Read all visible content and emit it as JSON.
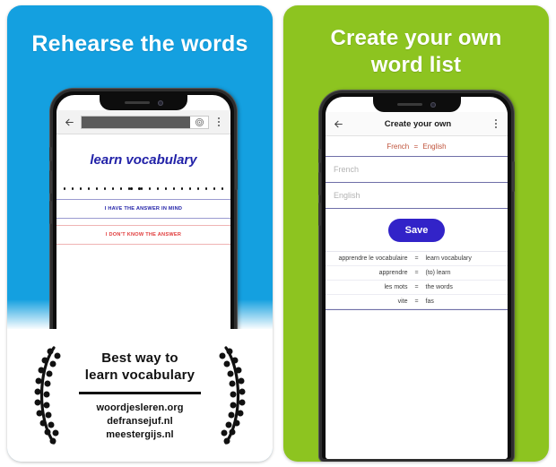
{
  "theme": {
    "blue": "#14a0e0",
    "green": "#8dc420",
    "navy": "#2222a8",
    "red": "#e03a3a",
    "save_button": "#3223c8",
    "lang_header": "#c0543c"
  },
  "left_card": {
    "headline": "Rehearse the words",
    "browser": {
      "back_icon": "back-arrow-icon",
      "url_value": "",
      "url_icon": "page-info-icon",
      "menu_icon": "kebab-menu-icon"
    },
    "page": {
      "title": "learn vocabulary",
      "blanks_pattern": [
        9,
        2,
        11
      ],
      "answer_known": "I HAVE THE ANSWER IN MIND",
      "answer_unknown": "I DON'T KNOW THE ANSWER"
    },
    "promo": {
      "title_line1": "Best way to",
      "title_line2": "learn vocabulary",
      "links": [
        "woordjesleren.org",
        "defransejuf.nl",
        "meestergijs.nl"
      ],
      "wreath_icon": "laurel-wreath-icon"
    }
  },
  "right_card": {
    "headline_line1": "Create your own",
    "headline_line2": "word list",
    "appbar": {
      "back_icon": "back-arrow-icon",
      "title": "Create your own",
      "menu_icon": "kebab-menu-icon"
    },
    "form": {
      "lang_source": "French",
      "lang_equals": "=",
      "lang_target": "English",
      "source_placeholder": "French",
      "target_placeholder": "English",
      "save_label": "Save"
    },
    "wordlist": [
      {
        "source": "apprendre le vocabulaire",
        "eq": "=",
        "target": "learn vocabulary"
      },
      {
        "source": "apprendre",
        "eq": "=",
        "target": "(to) learn"
      },
      {
        "source": "les mots",
        "eq": "=",
        "target": "the words"
      },
      {
        "source": "vite",
        "eq": "=",
        "target": "fas"
      }
    ]
  }
}
